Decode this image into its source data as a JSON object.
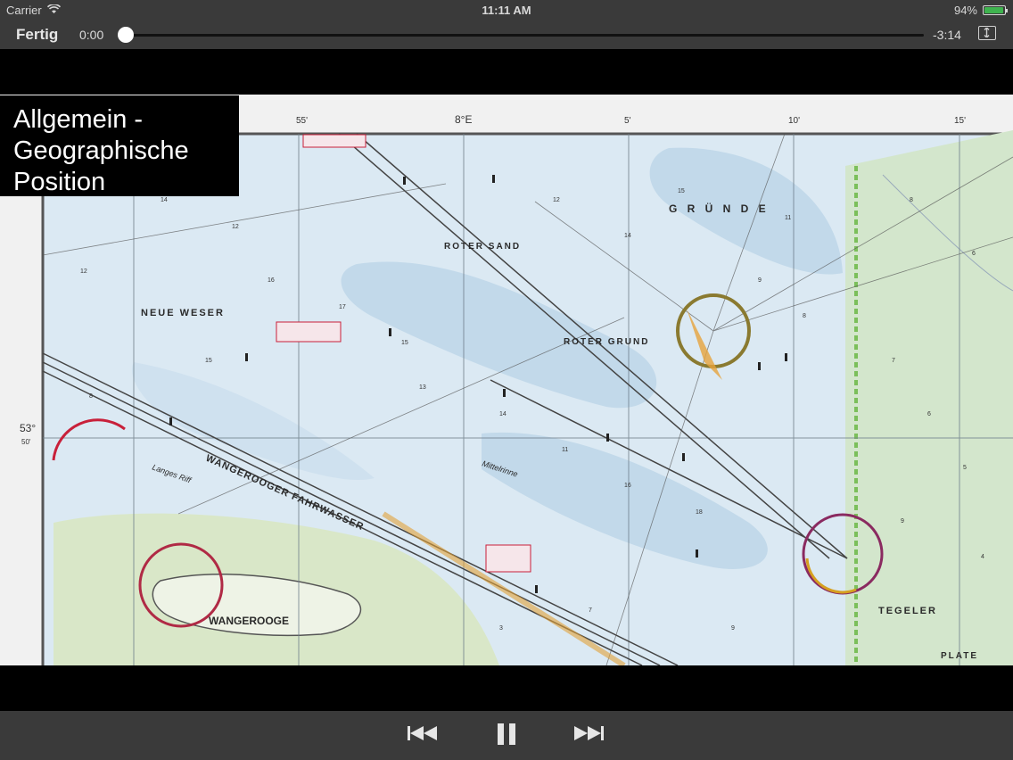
{
  "status_bar": {
    "carrier": "Carrier",
    "time": "11:11 AM",
    "battery_percent": "94%",
    "battery_level": 0.94
  },
  "player": {
    "done_label": "Fertig",
    "elapsed": "0:00",
    "remaining": "-3:14",
    "progress": 0.0
  },
  "video": {
    "title_line1": "Allgemein -",
    "title_line2": "Geographische",
    "title_line3": "Position",
    "map": {
      "top_labels": [
        "55'",
        "8°E",
        "5'",
        "10'",
        "15'"
      ],
      "left_labels": [
        "53°",
        "50'"
      ],
      "places": {
        "gruende": "G R Ü N D E",
        "roter_sand": "ROTER SAND",
        "neue_weser": "NEUE WESER",
        "roter_grund": "ROTER GRUND",
        "wangerooge": "WANGEROOGE",
        "fahrwasser": "WANGEROOGER FAHRWASSER",
        "tegeler": "TEGELER",
        "plate": "PLATE",
        "langes_riff": "Langes Riff",
        "mittelrinne": "Mittelrinne"
      }
    }
  },
  "colors": {
    "bar": "#3a3a3a",
    "battery": "#3fb34f",
    "water": "#dbe9f3",
    "shallow": "#c2d9ea",
    "land": "#d9e7c8",
    "chart_red": "#c8203a"
  }
}
